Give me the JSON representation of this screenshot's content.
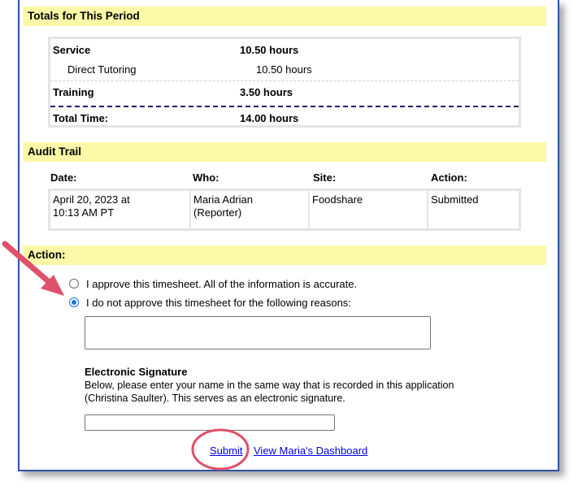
{
  "totals": {
    "header": "Totals for This Period",
    "rows": [
      {
        "label": "Service",
        "value": "10.50 hours"
      },
      {
        "label": "Direct Tutoring",
        "value": "10.50 hours"
      },
      {
        "label": "Training",
        "value": "3.50 hours"
      },
      {
        "label": "Total Time:",
        "value": "14.00 hours"
      }
    ]
  },
  "audit": {
    "header": "Audit Trail",
    "columns": [
      "Date:",
      "Who:",
      "Site:",
      "Action:"
    ],
    "row": {
      "date_line1": "April 20, 2023 at",
      "date_line2": "10:13 AM PT",
      "who_line1": "Maria Adrian",
      "who_line2": "(Reporter)",
      "site": "Foodshare",
      "action": "Submitted"
    }
  },
  "action": {
    "header": "Action:",
    "options": [
      {
        "label": "I approve this timesheet. All of the information is accurate.",
        "selected": false
      },
      {
        "label": "I do not approve this timesheet for the following reasons:",
        "selected": true
      }
    ],
    "reasons_value": "",
    "signature": {
      "title": "Electronic Signature",
      "line1": "Below, please enter your name in the same way that is recorded in this application",
      "line2": "(Christina Saulter). This serves as an electronic signature.",
      "value": ""
    },
    "submit_label": "Submit",
    "dashboard_label": "View Maria's Dashboard"
  },
  "colors": {
    "section_header_bg": "#fbf8a7",
    "frame_border": "#2f52a3",
    "annotation": "#e0506a",
    "link": "#0000ee",
    "radio_selected": "#1a73e8"
  }
}
